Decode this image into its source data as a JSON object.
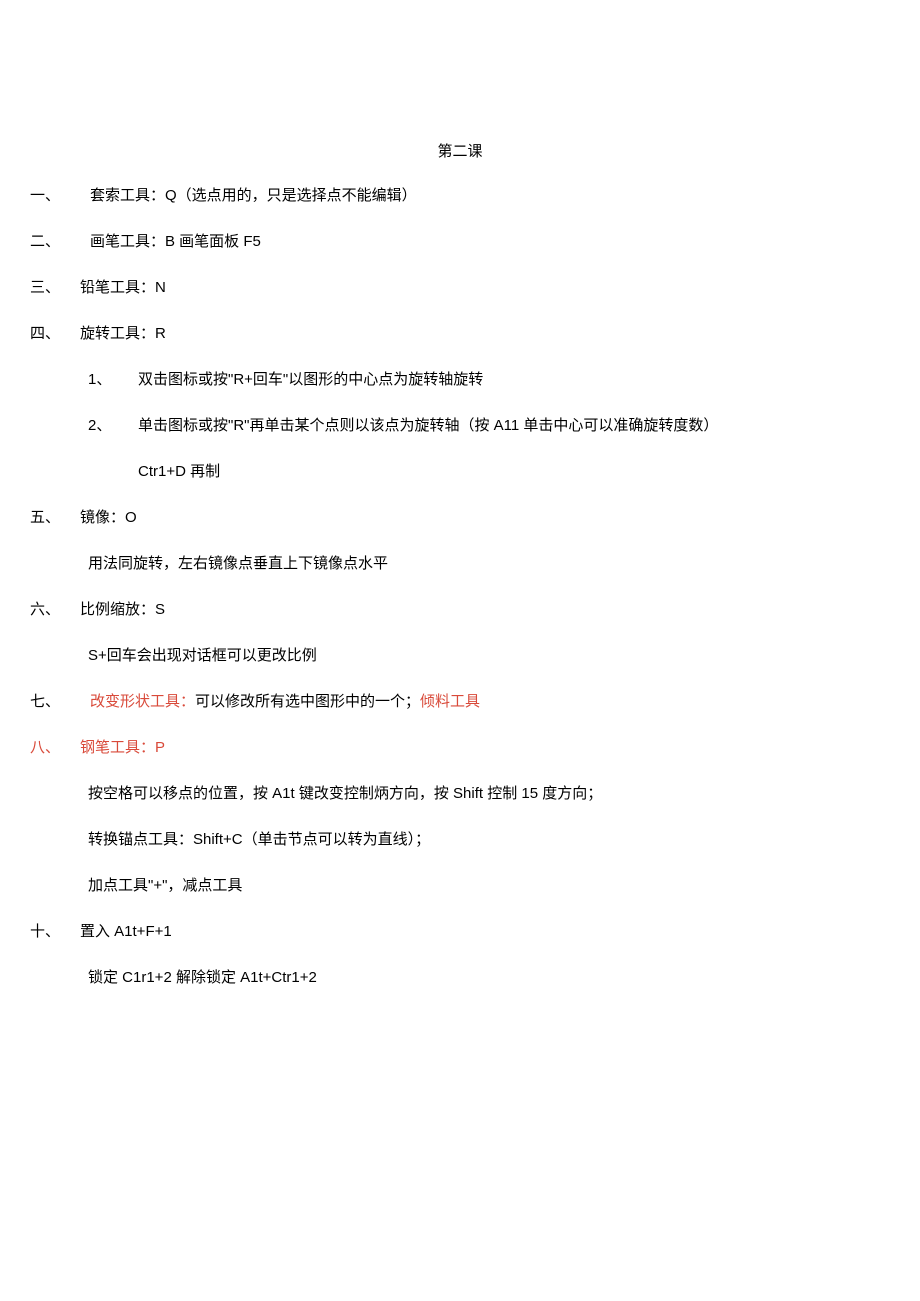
{
  "title": "第二课",
  "items": {
    "i1": {
      "marker": "一、",
      "text": "套索工具：Q（选点用的，只是选择点不能编辑）"
    },
    "i2": {
      "marker": "二、",
      "text": "画笔工具：B 画笔面板 F5"
    },
    "i3": {
      "marker": "三、",
      "text": "铅笔工具：N"
    },
    "i4": {
      "marker": "四、",
      "text": "旋转工具：R",
      "sub": {
        "s1": {
          "marker": "1、",
          "text": "双击图标或按\"R+回车\"以图形的中心点为旋转轴旋转"
        },
        "s2": {
          "marker": "2、",
          "text": "单击图标或按\"R\"再单击某个点则以该点为旋转轴（按 A11 单击中心可以准确旋转度数）"
        },
        "s3": {
          "text": "Ctr1+D 再制"
        }
      }
    },
    "i5": {
      "marker": "五、",
      "text": "镜像：O",
      "sub": {
        "s1": {
          "text": "用法同旋转，左右镜像点垂直上下镜像点水平"
        }
      }
    },
    "i6": {
      "marker": "六、",
      "text": "比例缩放：S",
      "sub": {
        "s1": {
          "text": "S+回车会出现对话框可以更改比例"
        }
      }
    },
    "i7": {
      "marker": "七、",
      "red1": "改变形状工具：",
      "mid": "可以修改所有选中图形中的一个；",
      "red2": "倾料工具"
    },
    "i8": {
      "marker": "八、",
      "text": "钢笔工具：P",
      "sub": {
        "s1": {
          "text": "按空格可以移点的位置，按 A1t 键改变控制炳方向，按 Shift 控制 15 度方向；"
        },
        "s2": {
          "text": "转换锚点工具：Shift+C（单击节点可以转为直线）；"
        },
        "s3": {
          "text": "加点工具\"+\"，减点工具"
        }
      }
    },
    "i10": {
      "marker": "十、",
      "text": "置入 A1t+F+1",
      "sub": {
        "s1": {
          "text": "锁定 C1r1+2 解除锁定 A1t+Ctr1+2"
        }
      }
    }
  }
}
